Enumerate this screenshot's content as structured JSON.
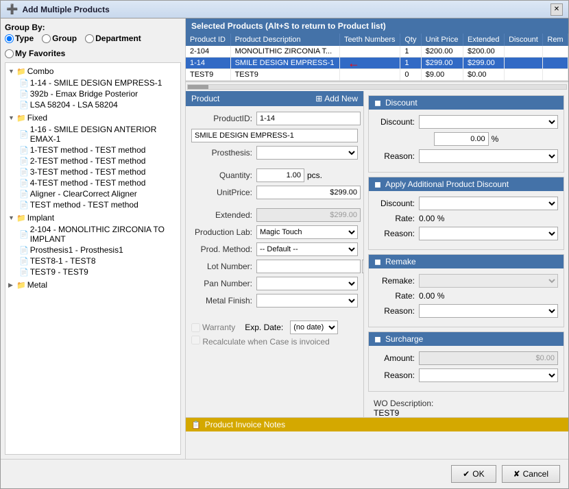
{
  "window": {
    "title": "Add Multiple Products",
    "icon": "➕"
  },
  "group_by": {
    "label": "Group By:",
    "options": [
      "Type",
      "Group",
      "Department",
      "My Favorites"
    ],
    "selected": "Type"
  },
  "tree": {
    "items": [
      {
        "id": "combo",
        "label": "Combo",
        "expanded": true,
        "children": [
          {
            "id": "1-14-smile",
            "label": "1-14 - SMILE DESIGN EMPRESS-1"
          },
          {
            "id": "392b-emax",
            "label": "392b - Emax Bridge Posterior"
          },
          {
            "id": "lsa-58204",
            "label": "LSA 58204 - LSA 58204"
          }
        ]
      },
      {
        "id": "fixed",
        "label": "Fixed",
        "expanded": true,
        "children": [
          {
            "id": "1-16-anterior",
            "label": "1-16 - SMILE DESIGN ANTERIOR EMAX-1"
          },
          {
            "id": "1-test",
            "label": "1-TEST method - TEST method"
          },
          {
            "id": "2-test",
            "label": "2-TEST method - TEST method"
          },
          {
            "id": "3-test",
            "label": "3-TEST method - TEST method"
          },
          {
            "id": "4-test",
            "label": "4-TEST method - TEST method"
          },
          {
            "id": "aligner",
            "label": "Aligner - ClearCorrect Aligner"
          },
          {
            "id": "test-method",
            "label": "TEST method - TEST method"
          }
        ]
      },
      {
        "id": "implant",
        "label": "Implant",
        "expanded": true,
        "children": [
          {
            "id": "2-104-implant",
            "label": "2-104 - MONOLITHIC ZIRCONIA TO IMPLANT"
          },
          {
            "id": "prosthesis1",
            "label": "Prosthesis1 - Prosthesis1"
          },
          {
            "id": "test8-1",
            "label": "TEST8-1 - TEST8"
          },
          {
            "id": "test9-implant",
            "label": "TEST9 - TEST9"
          }
        ]
      },
      {
        "id": "metal",
        "label": "Metal",
        "expanded": false,
        "children": []
      }
    ]
  },
  "selected_products": {
    "header": "Selected Products (Alt+S to return to Product list)",
    "columns": [
      "Product ID",
      "Product Description",
      "Teeth Numbers",
      "Qty",
      "Unit Price",
      "Extended",
      "Discount",
      "Rem"
    ],
    "rows": [
      {
        "product_id": "2-104",
        "description": "MONOLITHIC ZIRCONIA T...",
        "teeth_numbers": "",
        "qty": "1",
        "unit_price": "$200.00",
        "extended": "$200.00",
        "discount": "",
        "rem": "",
        "selected": false
      },
      {
        "product_id": "1-14",
        "description": "SMILE DESIGN EMPRESS-1",
        "teeth_numbers": "",
        "qty": "1",
        "unit_price": "$299.00",
        "extended": "$299.00",
        "discount": "",
        "rem": "",
        "selected": true
      },
      {
        "product_id": "TEST9",
        "description": "TEST9",
        "teeth_numbers": "",
        "qty": "0",
        "unit_price": "$9.00",
        "extended": "$0.00",
        "discount": "",
        "rem": "",
        "selected": false
      }
    ]
  },
  "product_form": {
    "header": "Product",
    "add_new_label": "Add New",
    "product_id_label": "ProductID:",
    "product_id_value": "1-14",
    "product_name_value": "SMILE DESIGN EMPRESS-1",
    "prosthesis_label": "Prosthesis:",
    "prosthesis_value": "",
    "quantity_label": "Quantity:",
    "quantity_value": "1.00",
    "quantity_unit": "pcs.",
    "unit_price_label": "UnitPrice:",
    "unit_price_value": "$299.00",
    "extended_label": "Extended:",
    "extended_value": "$299.00",
    "production_lab_label": "Production Lab:",
    "production_lab_value": "Magic Touch",
    "prod_method_label": "Prod. Method:",
    "prod_method_value": "-- Default --",
    "lot_number_label": "Lot Number:",
    "lot_number_value": "",
    "pan_number_label": "Pan Number:",
    "pan_number_value": "",
    "metal_finish_label": "Metal Finish:",
    "metal_finish_value": "",
    "warranty_label": "Warranty",
    "exp_date_label": "Exp. Date:",
    "exp_date_value": "(no date)",
    "recalculate_label": "Recalculate when Case is invoiced"
  },
  "discount_section": {
    "header": "Discount",
    "discount_label": "Discount:",
    "discount_value": "",
    "pct_value": "0.00",
    "reason_label": "Reason:",
    "reason_value": ""
  },
  "apply_additional": {
    "header": "Apply Additional Product Discount",
    "discount_label": "Discount:",
    "discount_value": "",
    "rate_label": "Rate:",
    "rate_value": "0.00",
    "reason_label": "Reason:",
    "reason_value": ""
  },
  "remake_section": {
    "header": "Remake",
    "remake_label": "Remake:",
    "remake_value": "",
    "rate_label": "Rate:",
    "rate_value": "0.00",
    "reason_label": "Reason:",
    "reason_value": ""
  },
  "surcharge_section": {
    "header": "Surcharge",
    "amount_label": "Amount:",
    "amount_value": "$0.00",
    "reason_label": "Reason:",
    "reason_value": ""
  },
  "wo_description": {
    "label": "WO Description:",
    "value": "TEST9"
  },
  "product_invoice_notes": {
    "header": "Product Invoice Notes"
  },
  "footer": {
    "ok_label": "✔ OK",
    "cancel_label": "✘ Cancel"
  }
}
